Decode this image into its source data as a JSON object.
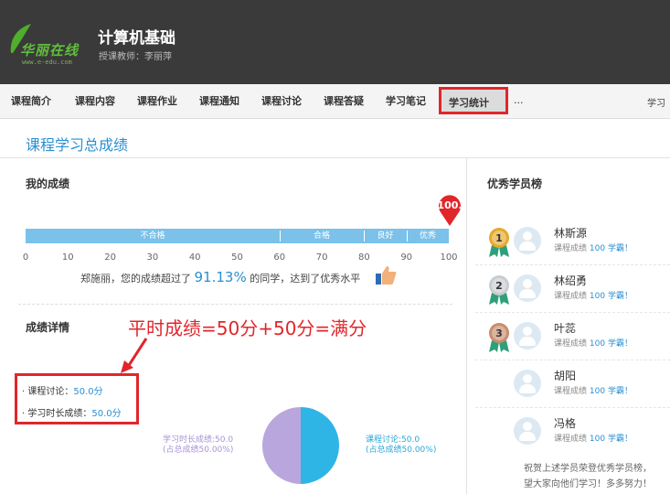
{
  "header": {
    "logo_text": "华丽在线",
    "logo_sub": "www.e-edu.com",
    "course_title": "计算机基础",
    "teacher": "授课教师：李丽萍"
  },
  "nav": {
    "items": [
      "课程简介",
      "课程内容",
      "课程作业",
      "课程通知",
      "课程讨论",
      "课程答疑",
      "学习笔记"
    ],
    "active": "学习统计",
    "more": "...",
    "right": "学习"
  },
  "section_title": "课程学习总成绩",
  "my_score": {
    "title": "我的成绩",
    "score": "100.",
    "score_value": 100,
    "bands": [
      "不合格",
      "合格",
      "良好",
      "优秀"
    ],
    "ticks": [
      "0",
      "10",
      "20",
      "30",
      "40",
      "50",
      "60",
      "70",
      "80",
      "90",
      "100"
    ],
    "compare_prefix": "郑施丽，您的成绩超过了",
    "compare_pct": "91.13%",
    "compare_suffix": "的同学，达到了优秀水平"
  },
  "details": {
    "title": "成绩详情",
    "annotation": "平时成绩=50分+50分=满分",
    "items": [
      {
        "label": "课程讨论：",
        "value": "50.0分"
      },
      {
        "label": "学习时长成绩：",
        "value": "50.0分"
      }
    ],
    "pie": {
      "left_label_1": "学习时长成绩:50.0",
      "left_label_2": "(占总成绩50.00%)",
      "right_label_1": "课程讨论:50.0",
      "right_label_2": "(占总成绩50.00%)",
      "slices": [
        50,
        50
      ],
      "colors": [
        "#b8a6dd",
        "#2fb4e6"
      ]
    }
  },
  "ranking": {
    "title": "优秀学员榜",
    "students": [
      {
        "rank": "1",
        "name": "林斯源",
        "info_label": "课程成绩",
        "score": "100",
        "action": "学霸！"
      },
      {
        "rank": "2",
        "name": "林绍勇",
        "info_label": "课程成绩",
        "score": "100",
        "action": "学霸！"
      },
      {
        "rank": "3",
        "name": "叶蕊",
        "info_label": "课程成绩",
        "score": "100",
        "action": "学霸！"
      },
      {
        "rank": "",
        "name": "胡阳",
        "info_label": "课程成绩",
        "score": "100",
        "action": "学霸！"
      },
      {
        "rank": "",
        "name": "冯格",
        "info_label": "课程成绩",
        "score": "100",
        "action": "学霸！"
      }
    ],
    "footer_1": "祝贺上述学员荣登优秀学员榜，",
    "footer_2": "望大家向他们学习！多多努力！"
  },
  "colors": {
    "header_bg": "#3a3a3a",
    "accent": "#2a8fd1",
    "highlight": "#e0262b",
    "bar": "#7bc1ea"
  }
}
